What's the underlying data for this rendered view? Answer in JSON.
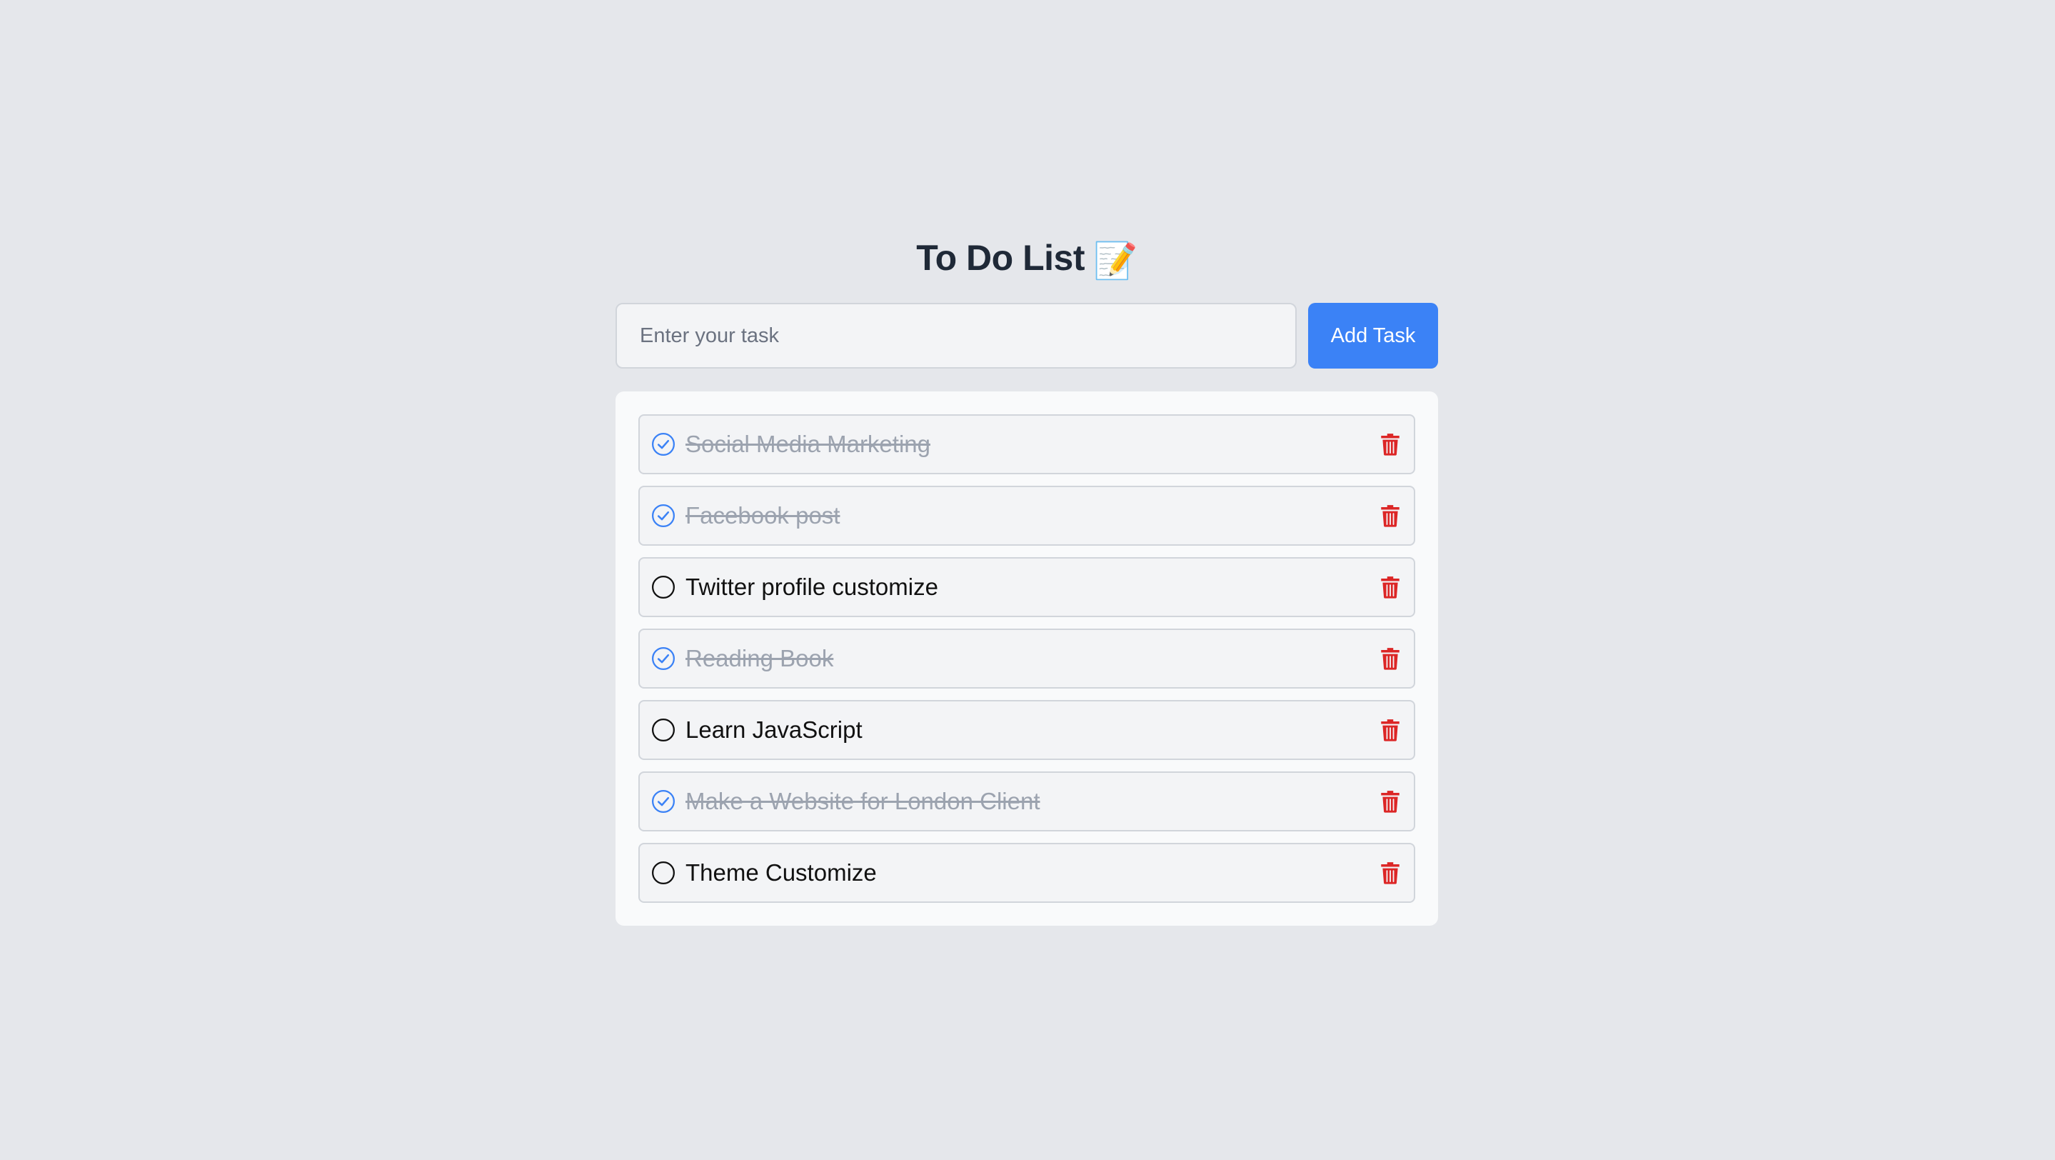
{
  "header": {
    "title": "To Do List",
    "title_emoji": "📝"
  },
  "task_form": {
    "input_placeholder": "Enter your task",
    "input_value": "",
    "add_button_label": "Add Task"
  },
  "tasks": [
    {
      "text": "Social Media Marketing",
      "completed": true
    },
    {
      "text": "Facebook post",
      "completed": true
    },
    {
      "text": "Twitter profile customize",
      "completed": false
    },
    {
      "text": "Reading Book",
      "completed": true
    },
    {
      "text": "Learn JavaScript",
      "completed": false
    },
    {
      "text": "Make a Website for London Client",
      "completed": true
    },
    {
      "text": "Theme Customize",
      "completed": false
    }
  ],
  "icons": {
    "completed": "check-circle-icon",
    "pending": "empty-circle-icon",
    "delete": "trash-icon"
  },
  "colors": {
    "accent": "#3b82f6",
    "delete": "#dc2626",
    "completed_text": "#9ca3af"
  }
}
